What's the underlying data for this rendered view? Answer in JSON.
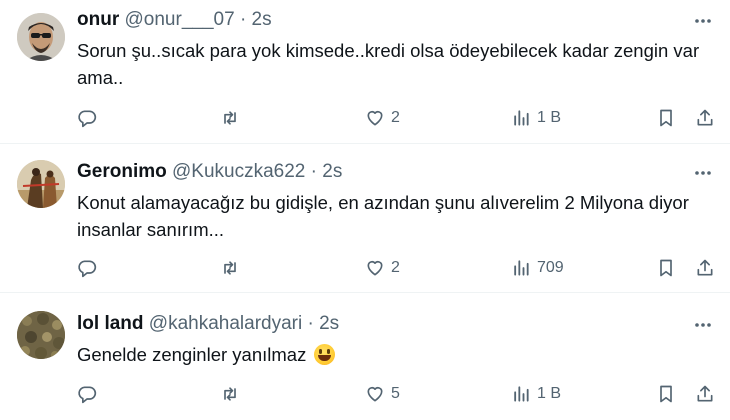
{
  "tweets": [
    {
      "name": "onur",
      "handle": "@onur___07",
      "separator": "·",
      "time": "2s",
      "text": "Sorun şu..sıcak para yok kimsede..kredi olsa ödeyebilecek kadar zengin var ama..",
      "likes": "2",
      "views": "1 B",
      "avatar_color": "#d6d2c8"
    },
    {
      "name": "Geronimo",
      "handle": "@Kukuczka622",
      "separator": "·",
      "time": "2s",
      "text": "Konut alamayacağız bu gidişle, en azından şunu alıverelim 2 Milyona diyor insanlar sanırım...",
      "likes": "2",
      "views": "709",
      "avatar_color": "#cfc3a9"
    },
    {
      "name": "lol land",
      "handle": "@kahkahalardyari",
      "separator": "·",
      "time": "2s",
      "text": "Genelde zenginler yanılmaz",
      "emoji": "grinning-face",
      "likes": "5",
      "views": "1 B",
      "avatar_color": "#7d6f4a"
    }
  ],
  "icons": {
    "reply": "reply-icon",
    "retweet": "retweet-icon",
    "like": "heart-icon",
    "views": "views-icon",
    "bookmark": "bookmark-icon",
    "share": "share-icon",
    "more": "more-icon"
  },
  "colors": {
    "text": "#0f1419",
    "secondary": "#536471",
    "divider": "#eff3f4"
  }
}
